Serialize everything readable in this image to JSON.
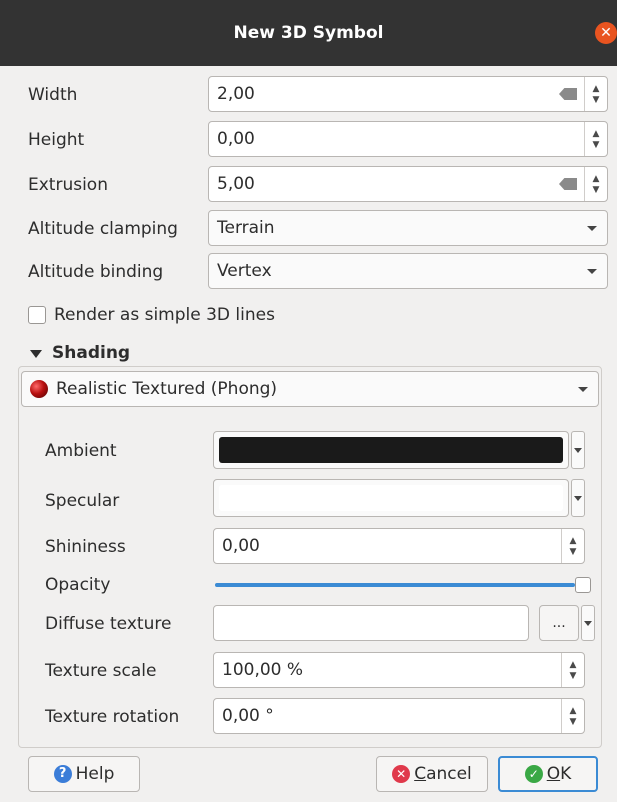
{
  "window": {
    "title": "New 3D Symbol",
    "close_icon": "close-icon"
  },
  "fields": {
    "width": {
      "label": "Width",
      "value": "2,00"
    },
    "height": {
      "label": "Height",
      "value": "0,00"
    },
    "extrusion": {
      "label": "Extrusion",
      "value": "5,00"
    },
    "altitude_clamping": {
      "label": "Altitude clamping",
      "value": "Terrain"
    },
    "altitude_binding": {
      "label": "Altitude binding",
      "value": "Vertex"
    },
    "render_simple_lines": {
      "label": "Render as simple 3D lines",
      "checked": false
    }
  },
  "shading": {
    "title": "Shading",
    "technique": "Realistic Textured (Phong)",
    "ambient": {
      "label": "Ambient",
      "color": "#1a1a1a"
    },
    "specular": {
      "label": "Specular",
      "color": "#ffffff"
    },
    "shininess": {
      "label": "Shininess",
      "value": "0,00"
    },
    "opacity": {
      "label": "Opacity",
      "value": 1.0
    },
    "diffuse_texture": {
      "label": "Diffuse texture",
      "value": "",
      "browse_label": "..."
    },
    "texture_scale": {
      "label": "Texture scale",
      "value": "100,00 %"
    },
    "texture_rotation": {
      "label": "Texture rotation",
      "value": "0,00 °"
    }
  },
  "buttons": {
    "help": "Help",
    "cancel_pre": "",
    "cancel_u": "C",
    "cancel_post": "ancel",
    "ok_u": "O",
    "ok_post": "K"
  },
  "colors": {
    "accent": "#3b8bd4",
    "titlebar": "#333333",
    "close": "#e95420"
  }
}
